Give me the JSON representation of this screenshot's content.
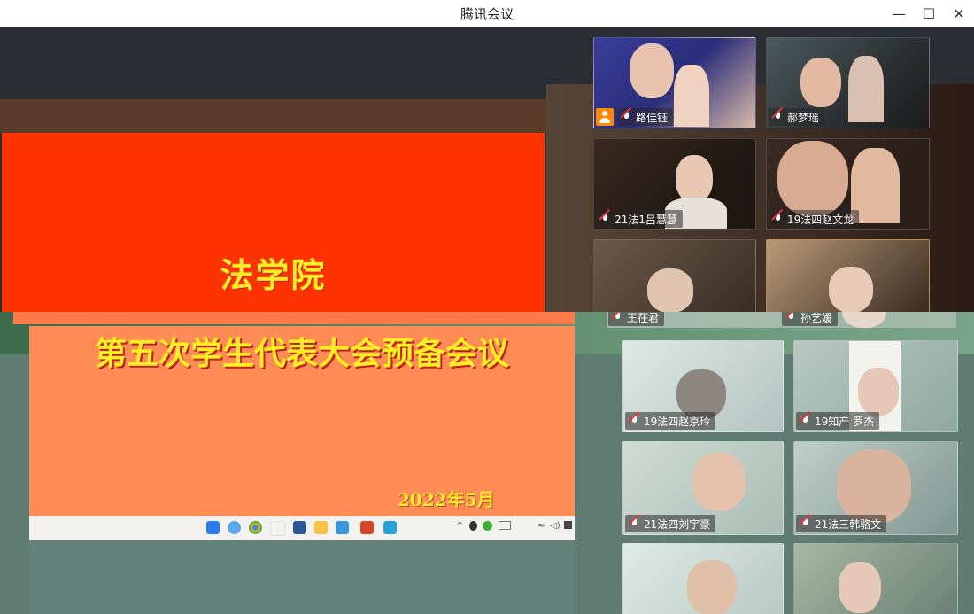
{
  "window": {
    "title": "腾讯会议",
    "minimize": "—",
    "maximize": "☐",
    "close": "✕"
  },
  "slide": {
    "college": "法学院",
    "meeting_title": "第五次学生代表大会预备会议",
    "date": "2022年5月"
  },
  "participants": [
    {
      "name": "路佳钰",
      "host": true
    },
    {
      "name": "郝梦瑶"
    },
    {
      "name": "21法1吕慧慧"
    },
    {
      "name": "19法四赵文龙"
    },
    {
      "name": "王茌君"
    },
    {
      "name": "孙艺媛"
    },
    {
      "name": "19法四赵京玲"
    },
    {
      "name": "19知产 罗杰"
    },
    {
      "name": "21法四刘宇豪"
    },
    {
      "name": "21法三韩骆文"
    }
  ],
  "taskbar": {
    "icons": [
      "windows-start-icon",
      "search-icon",
      "chrome-icon",
      "folder-icon",
      "word-icon",
      "explorer-icon",
      "store-icon",
      "powerpoint-icon",
      "app-icon"
    ],
    "tray": [
      "chevron-up-icon",
      "qq-icon",
      "wechat-icon",
      "battery-icon",
      "wifi-icon",
      "volume-icon",
      "input-icon"
    ]
  },
  "colors": {
    "slide_red": "#ff3300",
    "slide_orange": "#ff8c55",
    "title_yellow": "#ffee22",
    "mic_muted": "#e53935",
    "host_badge": "#ff8a00"
  }
}
